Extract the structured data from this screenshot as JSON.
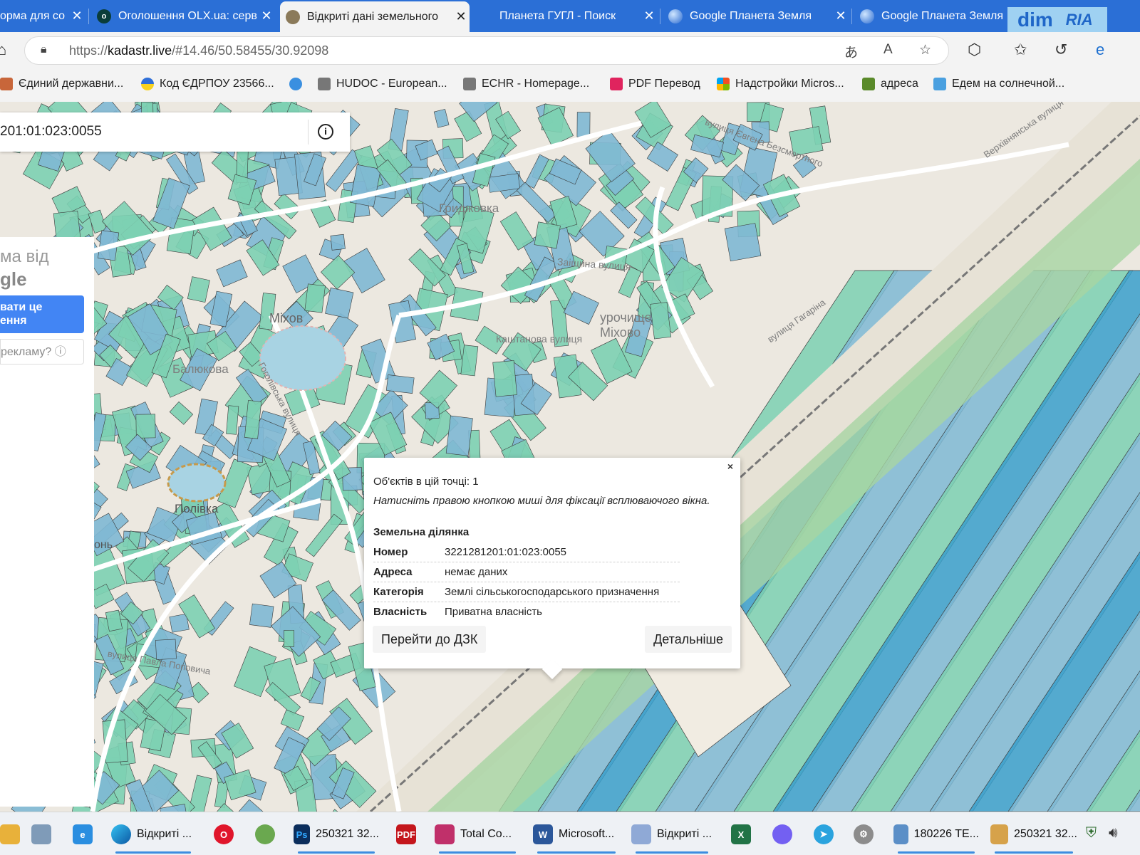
{
  "tabs": [
    {
      "title": "орма для со",
      "icon": "document-icon"
    },
    {
      "title": "Оголошення OLX.ua: серв",
      "icon": "olx-icon"
    },
    {
      "title": "Відкриті дані земельного",
      "icon": "globe-icon",
      "active": true
    },
    {
      "title": "Планета ГУГЛ - Поиск",
      "icon": "search-icon"
    },
    {
      "title": "Google Планета Земля",
      "icon": "earth-icon"
    },
    {
      "title": "Google Планета Земля",
      "icon": "earth-icon"
    }
  ],
  "promo": {
    "d1": "dim",
    "d2": "RIA"
  },
  "address": {
    "scheme": "https://",
    "host": "kadastr.live",
    "path": "/#14.46/50.58455/30.92098"
  },
  "bookmarks": [
    {
      "label": "Єдиний державни..."
    },
    {
      "label": "Код ЄДРПОУ 23566..."
    },
    {
      "label": ""
    },
    {
      "label": "HUDOC - European..."
    },
    {
      "label": "ECHR - Homepage..."
    },
    {
      "label": "PDF Перевод"
    },
    {
      "label": "Надстройки Micros..."
    },
    {
      "label": "адреса"
    },
    {
      "label": "Едем на солнечной..."
    }
  ],
  "search": {
    "query": "201:01:023:0055",
    "info_icon": "i"
  },
  "ad": {
    "line1": "ма від",
    "line2": "gle",
    "button": "вати це\nення",
    "link": "рекламу? ⓘ"
  },
  "map_labels": [
    "Гриджовка",
    "Заіщина вулиця",
    "урочище\nМіхово",
    "Каштанова вулиця",
    "Міхов",
    "Балюкова",
    "Гоголівська вулиця",
    "Полівка",
    "вулиця Павла Поповича",
    "вулиця Євгена Безсмертного",
    "Верхівнянська вулиця",
    "вулиця Гагаріна",
    "онь"
  ],
  "popup": {
    "close": "×",
    "count": "Об'єктів в цій точці: 1",
    "hint": "Натисніть правою кнопкою миші для фіксації всплюваючого вікна.",
    "heading": "Земельна ділянка",
    "rows": [
      {
        "key": "Номер",
        "value": "3221281201:01:023:0055"
      },
      {
        "key": "Адреса",
        "value": "немає даних"
      },
      {
        "key": "Категорія",
        "value": "Землі сільськогосподарського призначення"
      },
      {
        "key": "Власність",
        "value": "Приватна власність"
      }
    ],
    "btn_dzk": "Перейти до ДЗК",
    "btn_more": "Детальніше"
  },
  "taskbar": [
    {
      "label": "",
      "icon": "folder-icon"
    },
    {
      "label": "",
      "icon": "calculator-icon"
    },
    {
      "label": "",
      "icon": "ie-icon"
    },
    {
      "label": "Відкриті ...",
      "icon": "edge-icon"
    },
    {
      "label": "",
      "icon": "opera-icon"
    },
    {
      "label": "",
      "icon": "app-icon"
    },
    {
      "label": "250321 32...",
      "icon": "photoshop-icon"
    },
    {
      "label": "",
      "icon": "pdf-icon"
    },
    {
      "label": "Total Co...",
      "icon": "floppy-icon"
    },
    {
      "label": "Microsoft...",
      "icon": "word-icon"
    },
    {
      "label": "Відкриті ...",
      "icon": "doc-icon"
    },
    {
      "label": "",
      "icon": "excel-icon"
    },
    {
      "label": "",
      "icon": "viber-icon"
    },
    {
      "label": "",
      "icon": "telegram-icon"
    },
    {
      "label": "",
      "icon": "settings-icon"
    },
    {
      "label": "180226 TE...",
      "icon": "image-icon"
    },
    {
      "label": "250321 32...",
      "icon": "paint-icon"
    }
  ],
  "colors": {
    "accent": "#2b6fd6",
    "parcel_green": "#7dd0b2",
    "parcel_blue": "#7fb8d4",
    "parcel_dark": "#3a9fcb"
  }
}
